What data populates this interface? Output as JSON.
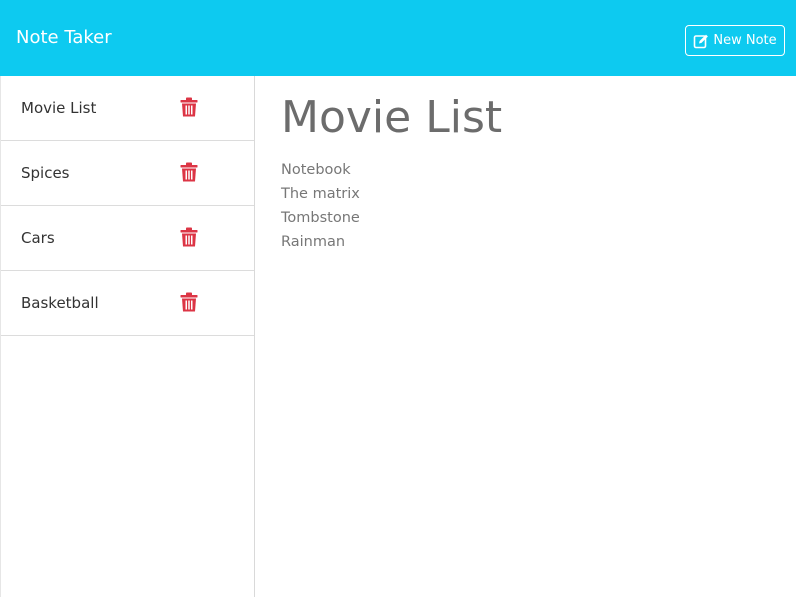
{
  "header": {
    "title": "Note Taker",
    "new_note_label": "New Note",
    "new_note_icon": "edit-icon"
  },
  "sidebar": {
    "delete_icon": "trash-icon",
    "items": [
      {
        "title": "Movie List"
      },
      {
        "title": "Spices"
      },
      {
        "title": "Cars"
      },
      {
        "title": "Basketball"
      }
    ]
  },
  "note": {
    "title": "Movie List",
    "lines": [
      "Notebook",
      "The matrix",
      "Tombstone",
      "Rainman"
    ]
  },
  "colors": {
    "header_bg": "#0dcaf0",
    "delete_icon": "#dc3545",
    "note_text": "#777777"
  }
}
